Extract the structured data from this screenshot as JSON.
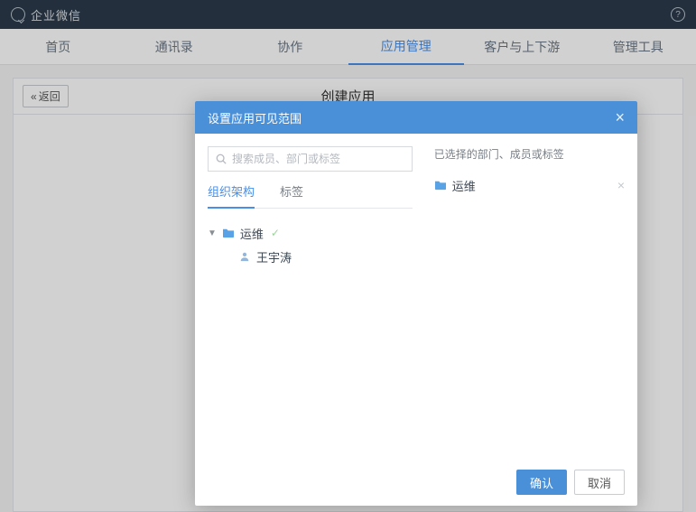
{
  "brand": "企业微信",
  "nav": {
    "items": [
      "首页",
      "通讯录",
      "协作",
      "应用管理",
      "客户与上下游",
      "管理工具"
    ],
    "active_index": 3
  },
  "page": {
    "back_label": "返回",
    "title": "创建应用"
  },
  "modal": {
    "title": "设置应用可见范围",
    "search_placeholder": "搜索成员、部门或标签",
    "subtabs": [
      "组织架构",
      "标签"
    ],
    "subtab_active_index": 0,
    "tree": {
      "root": {
        "label": "运维",
        "expanded": true,
        "checked": true
      },
      "children": [
        {
          "label": "王宇涛",
          "type": "member"
        }
      ]
    },
    "selected_section_title": "已选择的部门、成员或标签",
    "selected": [
      {
        "label": "运维",
        "type": "department"
      }
    ],
    "confirm_label": "确认",
    "cancel_label": "取消"
  }
}
